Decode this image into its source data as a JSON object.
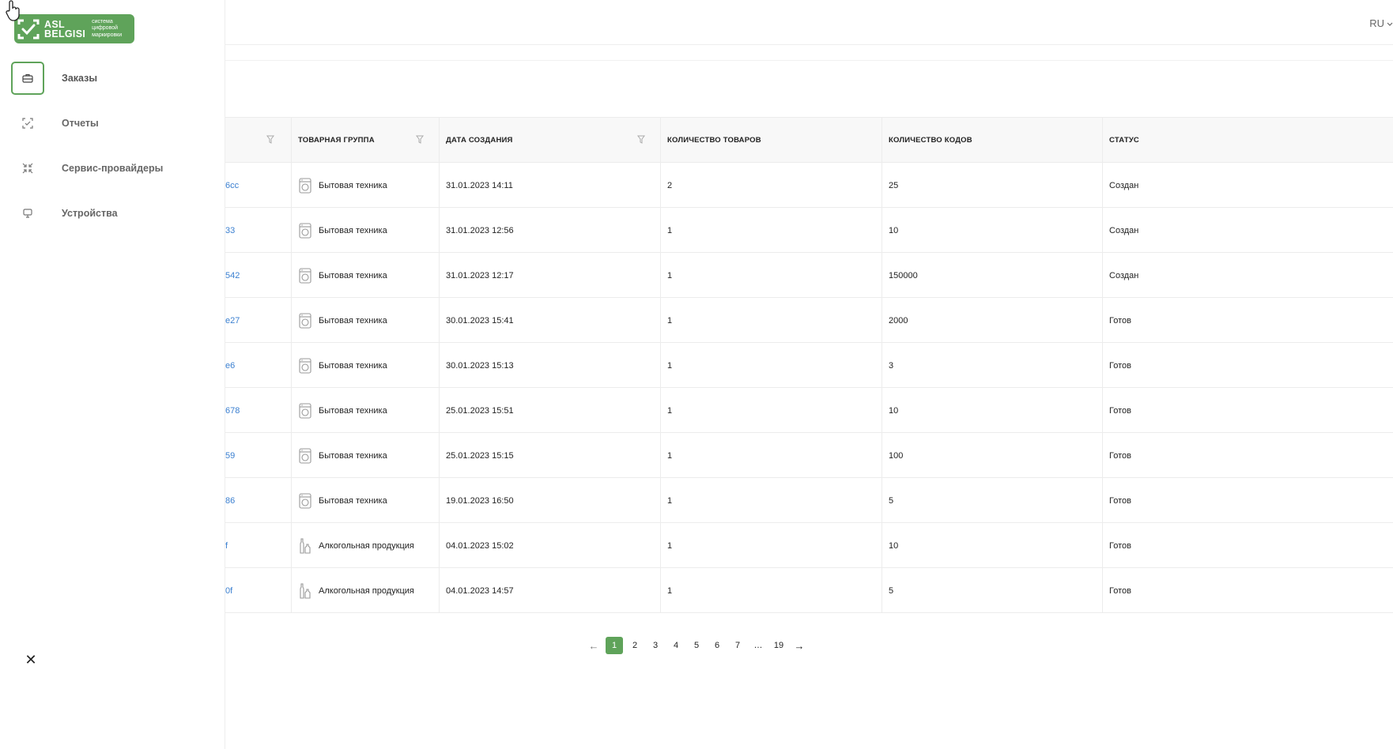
{
  "logo": {
    "brand_line1": "ASL",
    "brand_line2": "BELGISI",
    "tagline_line1": "система",
    "tagline_line2": "цифровой",
    "tagline_line3": "маркировки"
  },
  "sidebar": {
    "items": [
      {
        "label": "Заказы",
        "icon": "briefcase-icon",
        "active": true
      },
      {
        "label": "Отчеты",
        "icon": "report-icon",
        "active": false
      },
      {
        "label": "Сервис-провайдеры",
        "icon": "service-providers-icon",
        "active": false
      },
      {
        "label": "Устройства",
        "icon": "monitor-icon",
        "active": false
      }
    ],
    "close_glyph": "✕"
  },
  "header": {
    "language": "RU"
  },
  "table": {
    "columns": [
      "ТОВАРНАЯ ГРУППА",
      "ДАТА СОЗДАНИЯ",
      "КОЛИЧЕСТВО ТОВАРОВ",
      "КОЛИЧЕСТВО КОДОВ",
      "СТАТУС"
    ],
    "rows": [
      {
        "id": "6cc",
        "group": "Бытовая техника",
        "group_icon": "appliance-icon",
        "date": "31.01.2023 14:11",
        "items": "2",
        "codes": "25",
        "status": "Создан"
      },
      {
        "id": "33",
        "group": "Бытовая техника",
        "group_icon": "appliance-icon",
        "date": "31.01.2023 12:56",
        "items": "1",
        "codes": "10",
        "status": "Создан"
      },
      {
        "id": "542",
        "group": "Бытовая техника",
        "group_icon": "appliance-icon",
        "date": "31.01.2023 12:17",
        "items": "1",
        "codes": "150000",
        "status": "Создан"
      },
      {
        "id": "e27",
        "group": "Бытовая техника",
        "group_icon": "appliance-icon",
        "date": "30.01.2023 15:41",
        "items": "1",
        "codes": "2000",
        "status": "Готов"
      },
      {
        "id": "e6",
        "group": "Бытовая техника",
        "group_icon": "appliance-icon",
        "date": "30.01.2023 15:13",
        "items": "1",
        "codes": "3",
        "status": "Готов"
      },
      {
        "id": "678",
        "group": "Бытовая техника",
        "group_icon": "appliance-icon",
        "date": "25.01.2023 15:51",
        "items": "1",
        "codes": "10",
        "status": "Готов"
      },
      {
        "id": "59",
        "group": "Бытовая техника",
        "group_icon": "appliance-icon",
        "date": "25.01.2023 15:15",
        "items": "1",
        "codes": "100",
        "status": "Готов"
      },
      {
        "id": "86",
        "group": "Бытовая техника",
        "group_icon": "appliance-icon",
        "date": "19.01.2023 16:50",
        "items": "1",
        "codes": "5",
        "status": "Готов"
      },
      {
        "id": "f",
        "group": "Алкогольная продукция",
        "group_icon": "bottles-icon",
        "date": "04.01.2023 15:02",
        "items": "1",
        "codes": "10",
        "status": "Готов"
      },
      {
        "id": "0f",
        "group": "Алкогольная продукция",
        "group_icon": "bottles-icon",
        "date": "04.01.2023 14:57",
        "items": "1",
        "codes": "5",
        "status": "Готов"
      }
    ]
  },
  "pagination": {
    "prev": "←",
    "next": "→",
    "pages": [
      "1",
      "2",
      "3",
      "4",
      "5",
      "6",
      "7",
      "...",
      "19"
    ],
    "current": "1"
  },
  "colors": {
    "accent": "#5fa35a",
    "link": "#3a7fd0"
  }
}
